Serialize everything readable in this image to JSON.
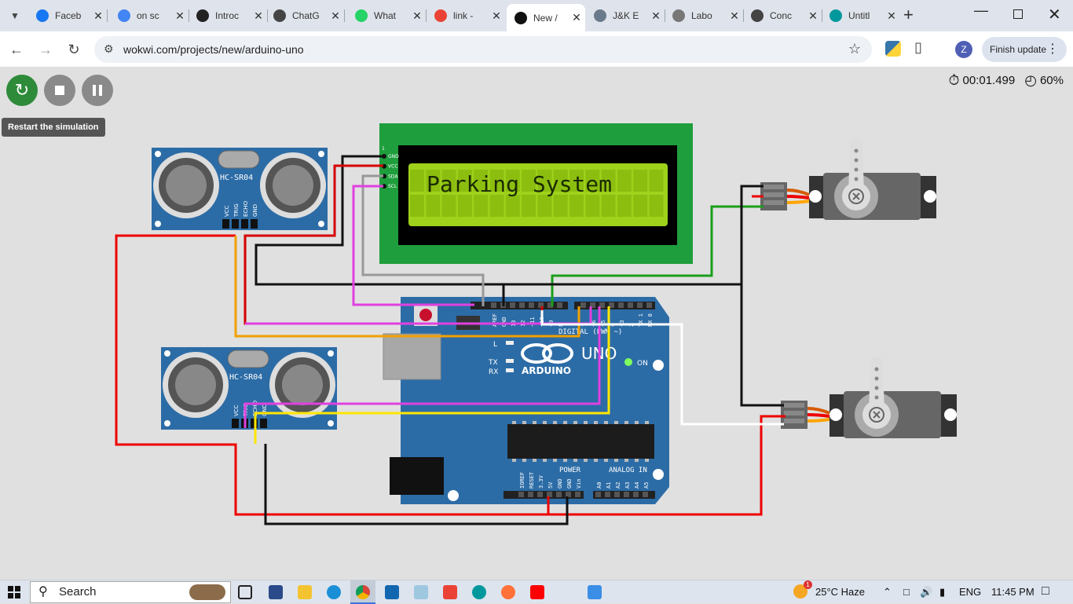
{
  "browser": {
    "tabs": [
      {
        "title": "Faceb",
        "icon": "facebook-icon",
        "color": "#1877f2"
      },
      {
        "title": "on sc",
        "icon": "google-icon",
        "color": "#4285f4"
      },
      {
        "title": "Introc",
        "icon": "openai-icon",
        "color": "#222222"
      },
      {
        "title": "ChatG",
        "icon": "chatgpt-icon",
        "color": "#444444"
      },
      {
        "title": "What",
        "icon": "whatsapp-icon",
        "color": "#25d366"
      },
      {
        "title": "link -",
        "icon": "gmail-icon",
        "color": "#ea4335"
      },
      {
        "title": "New /",
        "icon": "wokwi-icon",
        "color": "#111111",
        "active": true
      },
      {
        "title": "J&K E",
        "icon": "jk-icon",
        "color": "#6a7a8a"
      },
      {
        "title": "Labo",
        "icon": "labour-icon",
        "color": "#777777"
      },
      {
        "title": "Conc",
        "icon": "chatgpt-icon",
        "color": "#444444"
      },
      {
        "title": "Untitl",
        "icon": "arduino-icon",
        "color": "#00979d"
      }
    ],
    "url": "wokwi.com/projects/new/arduino-uno",
    "profile_initial": "Z",
    "finish_update": "Finish update"
  },
  "sim": {
    "tooltip": "Restart the simulation",
    "timer": "00:01.499",
    "speed": "60%"
  },
  "components": {
    "lcd_text": "Parking System",
    "lcd_pins": [
      "GND",
      "VCC",
      "SDA",
      "SCL"
    ],
    "lcd_pin1": "1",
    "sensor_label": "HC-SR04",
    "sensor_pins": [
      "VCC",
      "TRIG",
      "ECHO",
      "GND"
    ],
    "arduino": {
      "brand": "ARDUINO",
      "model": "UNO",
      "on": "ON",
      "tx": "TX",
      "rx": "RX",
      "l": "L",
      "digital": "DIGITAL (PWM ~)",
      "power": "POWER",
      "analog": "ANALOG IN",
      "top_pins": [
        "AREF",
        "GND",
        "13",
        "12",
        "~11",
        "~10",
        "~9",
        "8",
        "7",
        "~6",
        "~5",
        "4",
        "~3",
        "2",
        "TX 1",
        "RX 0"
      ],
      "bottom_pins": [
        "IOREF",
        "RESET",
        "3.3V",
        "5V",
        "GND",
        "GND",
        "Vin",
        "A0",
        "A1",
        "A2",
        "A3",
        "A4",
        "A5"
      ]
    }
  },
  "taskbar": {
    "search": "Search",
    "weather": "25°C  Haze",
    "lang": "ENG",
    "time": "11:45 PM",
    "weather_badge": "1"
  }
}
